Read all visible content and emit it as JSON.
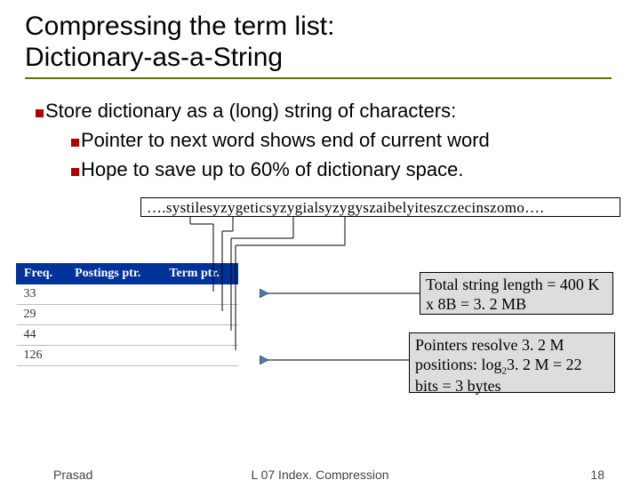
{
  "title": {
    "line1": "Compressing the term list:",
    "line2": "Dictionary-as-a-String"
  },
  "bullets": {
    "store": "Store dictionary as a (long) string of characters:",
    "pointer": "Pointer to next word shows end of current word",
    "hope": "Hope to save up to 60% of dictionary space."
  },
  "string_content": "….systilesyzygeticsyzygialsyzygyszaibelyiteszczecinszomo….",
  "table": {
    "headers": [
      "Freq.",
      "Postings ptr.",
      "Term ptr."
    ],
    "rows": [
      {
        "freq": "33"
      },
      {
        "freq": "29"
      },
      {
        "freq": "44"
      },
      {
        "freq": "126"
      }
    ]
  },
  "callouts": {
    "total_length": "Total string length = 400 K x 8B = 3. 2 MB",
    "pointers_pre": "Pointers resolve 3. 2 M positions: log",
    "pointers_sub": "2",
    "pointers_post": "3. 2 M = 22 bits = 3 bytes"
  },
  "footer": {
    "left": "Prasad",
    "center": "L 07 Index. Compression",
    "page": "18"
  }
}
